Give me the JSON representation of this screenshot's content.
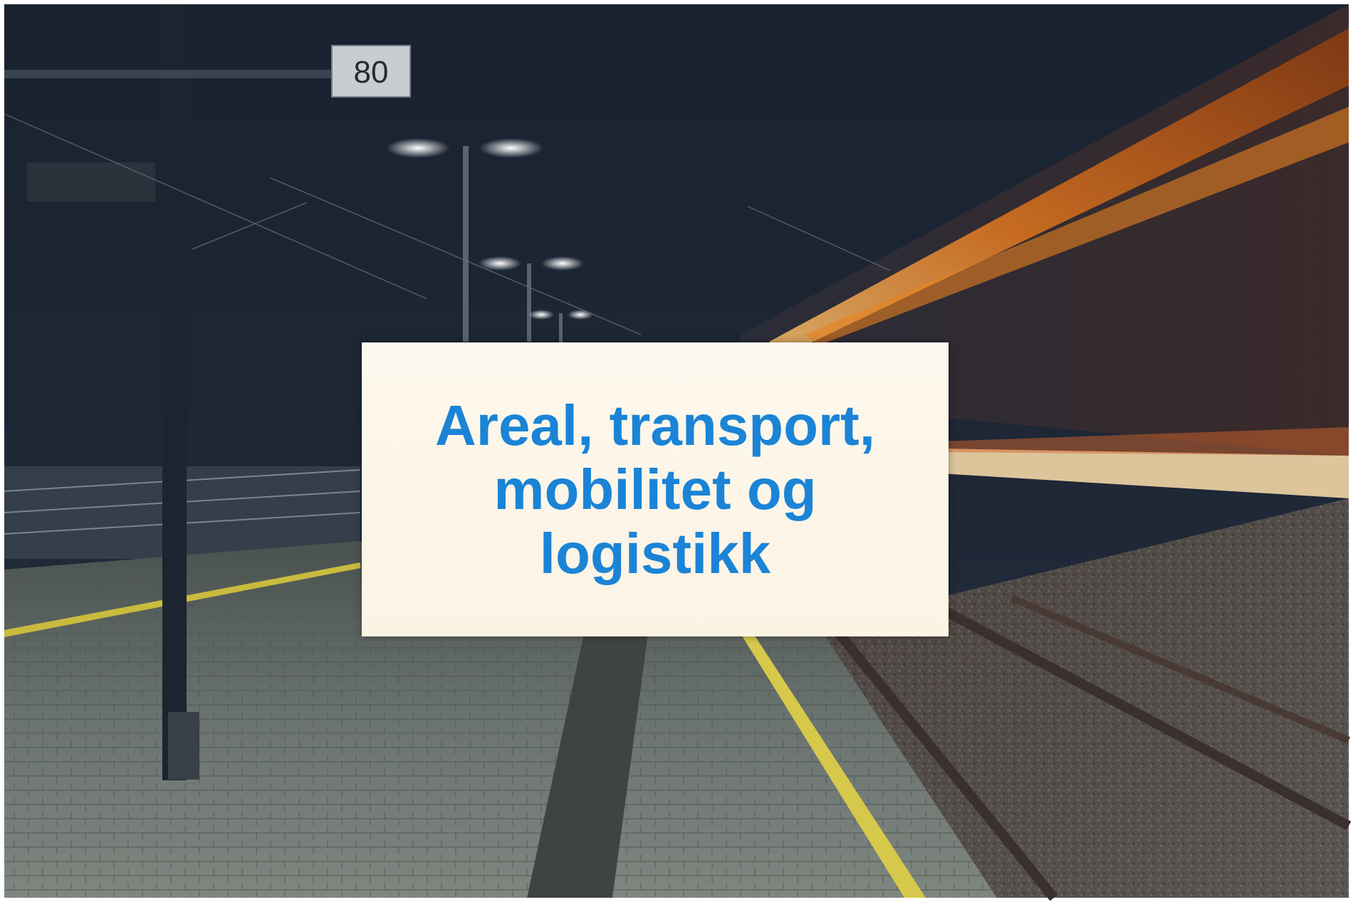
{
  "slide": {
    "title_lines": [
      "Areal, transport,",
      "mobilitet og",
      "logistikk"
    ]
  },
  "background": {
    "description_icon": "train-station-night-photo-icon",
    "platform_sign": "80",
    "colors": {
      "sky": "#1c2432",
      "platform": "#6e7570",
      "light_trail": "#f08a2a",
      "title_text": "#1b84d6",
      "card": "#fcf5e8"
    }
  }
}
